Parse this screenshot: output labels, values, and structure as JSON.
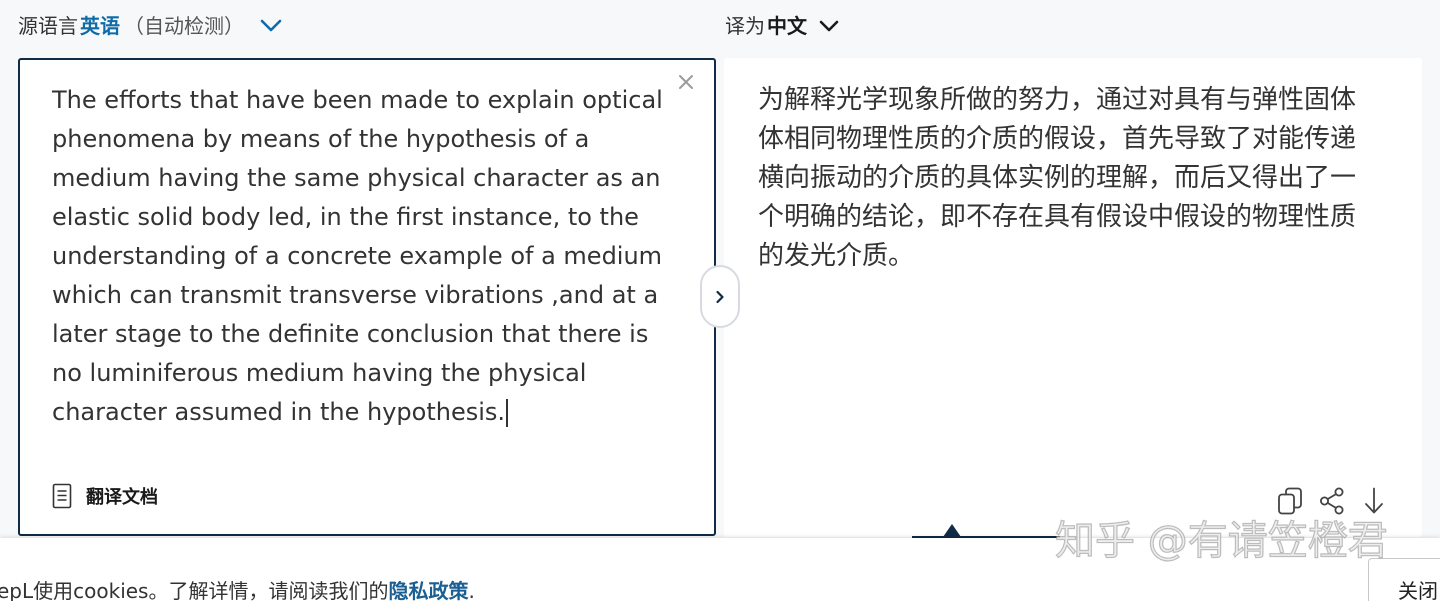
{
  "source_language": {
    "prefix": "源语言",
    "name": "英语",
    "detected": "（自动检测）"
  },
  "target_language": {
    "prefix": "译为",
    "name": "中文"
  },
  "source": {
    "lines": [
      "The efforts that have been made to explain optical",
      "phenomena by means of the hypothesis of a",
      "medium having the same physical character as an",
      "elastic solid body led, in the first instance, to the",
      "understanding of a concrete example of a medium",
      "which can transmit transverse vibrations ,and at a",
      "later stage to the definite conclusion that there is",
      "no luminiferous medium having the physical",
      "character assumed in the hypothesis."
    ]
  },
  "translate_document": {
    "label": "翻译文档"
  },
  "target": {
    "lines": [
      "为解释光学现象所做的努力，通过对具有与弹性固体",
      "体相同物理性质的介质的假设，首先导致了对能传递",
      "横向振动的介质的具体实例的理解，而后又得出了一",
      "个明确的结论，即不存在具有假设中假设的物理性质",
      "的发光介质。"
    ]
  },
  "watermark": "知乎 @有请笠橙君",
  "cookie_notice": {
    "text": "epL使用cookies。了解详情，请阅读我们的",
    "link": "隐私政策",
    "suffix": ".",
    "close_label": "关闭"
  },
  "icons": {
    "source_language_chevron": "chevron-down-icon",
    "target_language_chevron": "chevron-down-icon",
    "clear_source": "close-icon",
    "translate_document": "document-icon",
    "swap": "chevron-right-icon",
    "copy": "copy-icon",
    "share": "share-icon",
    "download": "download-icon"
  },
  "colors": {
    "accent_blue": "#0f6ba8",
    "link_blue": "#1b5f92",
    "panel_border": "#0f2b46",
    "text": "#333333",
    "page_background": "#f7f8f9"
  }
}
